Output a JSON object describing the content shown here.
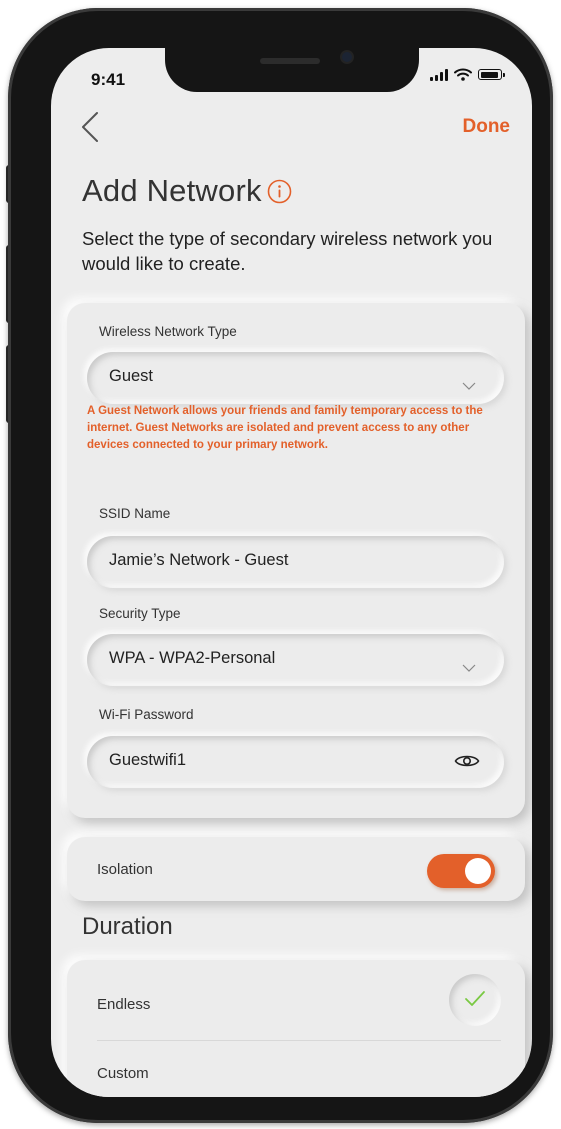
{
  "status_bar": {
    "time": "9:41"
  },
  "nav": {
    "back_icon": "chevron-left-icon",
    "done_label": "Done"
  },
  "header": {
    "title": "Add Network",
    "info_icon": "info-icon",
    "subtitle": "Select the type of secondary wireless network you would like to create."
  },
  "network_form": {
    "type_label": "Wireless Network Type",
    "type_value": "Guest",
    "type_description": "A Guest Network allows your friends and family temporary access to the internet. Guest Networks are isolated and prevent access to any other devices connected to your primary network.",
    "ssid_label": "SSID Name",
    "ssid_value": "Jamie’s Network - Guest",
    "security_label": "Security Type",
    "security_value": "WPA - WPA2-Personal",
    "password_label": "Wi-Fi Password",
    "password_value": "Guestwifi1",
    "password_icon": "eye-icon"
  },
  "isolation": {
    "label": "Isolation",
    "enabled": true
  },
  "duration": {
    "title": "Duration",
    "options": [
      {
        "label": "Endless",
        "selected": true
      },
      {
        "label": "Custom",
        "selected": false
      }
    ]
  },
  "colors": {
    "accent": "#e3602a",
    "check": "#7ac943",
    "background": "#ededed"
  }
}
